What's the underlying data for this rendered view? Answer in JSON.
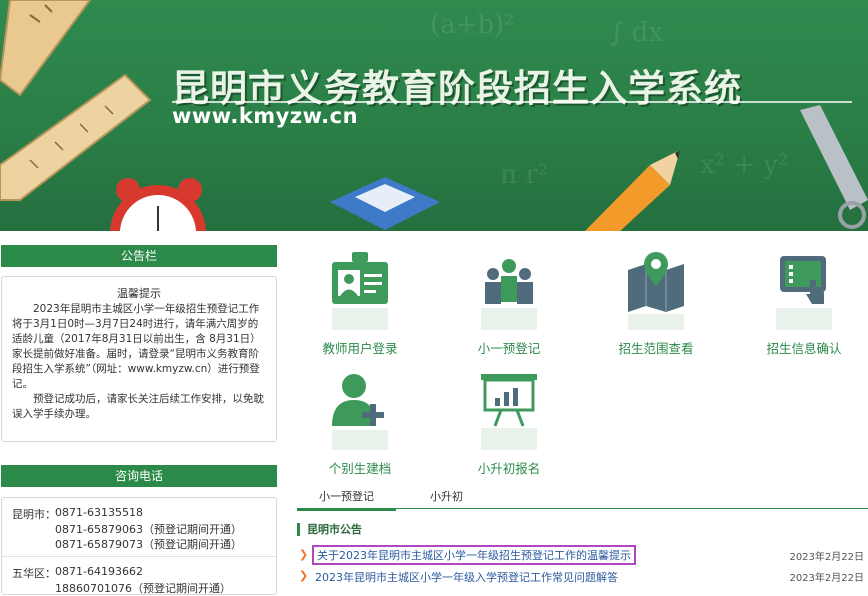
{
  "banner": {
    "title": "昆明市义务教育阶段招生入学系统",
    "url": "www.kmyzw.cn"
  },
  "notice_panel": {
    "header": "公告栏",
    "title": "温馨提示",
    "paragraph1": "2023年昆明市主城区小学一年级招生预登记工作将于3月1日0时—3月7日24时进行，请年满六周岁的适龄儿童（2017年8月31日以前出生，含 8月31日）家长提前做好准备。届时，请登录“昆明市义务教育阶段招生入学系统”（网址：www.kmyzw.cn）进行预登记。",
    "paragraph2": "预登记成功后，请家长关注后续工作安排，以免耽误入学手续办理。"
  },
  "contact_panel": {
    "header": "咨询电话",
    "rows": [
      {
        "district": "昆明市：",
        "phone": "0871-63135518"
      },
      {
        "district": "",
        "phone": "0871-65879063（预登记期间开通）"
      },
      {
        "district": "",
        "phone": "0871-65879073（预登记期间开通）"
      },
      {
        "district": "五华区：",
        "phone": "0871-64193662"
      },
      {
        "district": "",
        "phone": "18860701076（预登记期间开通）"
      }
    ]
  },
  "tiles": [
    {
      "label": "教师用户登录",
      "icon": "id-card-icon"
    },
    {
      "label": "小一预登记",
      "icon": "family-icon"
    },
    {
      "label": "招生范围查看",
      "icon": "map-pin-icon"
    },
    {
      "label": "招生信息确认",
      "icon": "touch-screen-icon"
    },
    {
      "label": "个别生建档",
      "icon": "add-user-icon"
    },
    {
      "label": "小升初报名",
      "icon": "bar-chart-board-icon"
    }
  ],
  "tabs": {
    "primary": "小一预登记",
    "secondary": "小升初"
  },
  "news": {
    "section_title": "昆明市公告",
    "items": [
      {
        "title": "关于2023年昆明市主城区小学一年级招生预登记工作的温馨提示",
        "date": "2023年2月22日"
      },
      {
        "title": "2023年昆明市主城区小学一年级入学预登记工作常见问题解答",
        "date": "2023年2月22日"
      }
    ]
  },
  "colors": {
    "brand_green": "#2b8a4a",
    "icon_green": "#3e9a5b",
    "icon_slate": "#4f6b7c",
    "link_blue": "#2c5aa0",
    "arrow_orange": "#e8772b",
    "highlight_purple": "#b146c2"
  }
}
